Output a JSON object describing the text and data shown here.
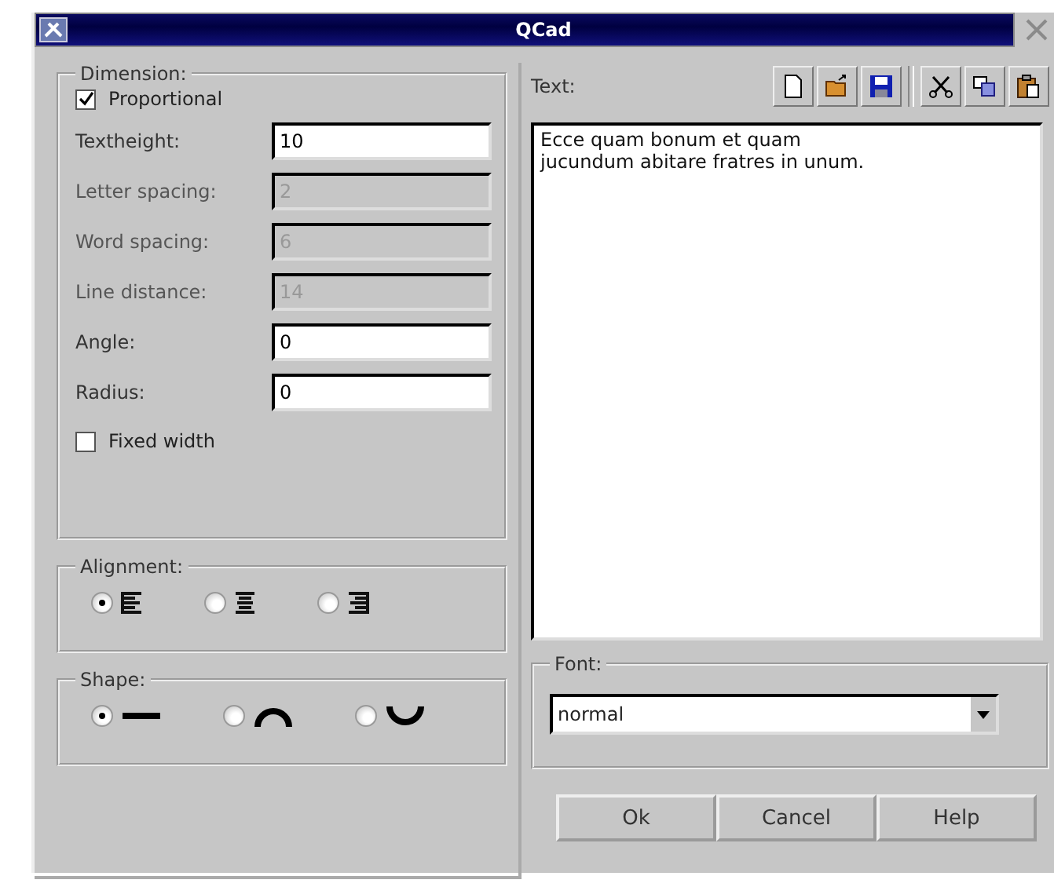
{
  "window": {
    "title": "QCad"
  },
  "dimension": {
    "title": "Dimension:",
    "proportional": {
      "label": "Proportional",
      "checked": true
    },
    "fields": [
      {
        "label": "Textheight:",
        "value": "10",
        "disabled": false
      },
      {
        "label": "Letter spacing:",
        "value": "2",
        "disabled": true
      },
      {
        "label": "Word spacing:",
        "value": "6",
        "disabled": true
      },
      {
        "label": "Line distance:",
        "value": "14",
        "disabled": true
      },
      {
        "label": "Angle:",
        "value": "0",
        "disabled": false
      },
      {
        "label": "Radius:",
        "value": "0",
        "disabled": false
      }
    ],
    "fixed_width": {
      "label": "Fixed width",
      "checked": false
    }
  },
  "alignment": {
    "title": "Alignment:",
    "options": [
      {
        "kind": "left",
        "selected": true
      },
      {
        "kind": "center",
        "selected": false
      },
      {
        "kind": "right",
        "selected": false
      }
    ]
  },
  "shape": {
    "title": "Shape:",
    "options": [
      {
        "kind": "line",
        "selected": true
      },
      {
        "kind": "arc_up",
        "selected": false
      },
      {
        "kind": "arc_down",
        "selected": false
      }
    ]
  },
  "text": {
    "label": "Text:",
    "toolbar": [
      {
        "kind": "new"
      },
      {
        "kind": "open"
      },
      {
        "kind": "save"
      },
      {
        "kind": "cut"
      },
      {
        "kind": "copy"
      },
      {
        "kind": "paste"
      }
    ],
    "value": "Ecce quam bonum et quam\njucundum abitare fratres in unum."
  },
  "font": {
    "title": "Font:",
    "value": "normal"
  },
  "buttons": [
    "Ok",
    "Cancel",
    "Help"
  ]
}
